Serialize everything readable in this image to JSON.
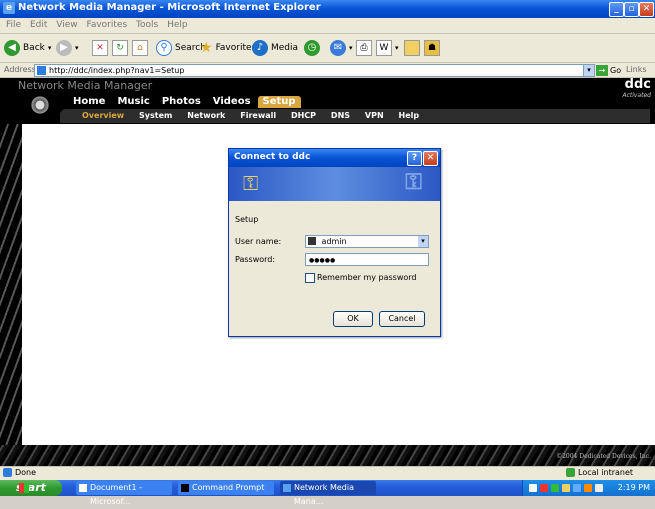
{
  "window": {
    "title": "Network Media Manager - Microsoft Internet Explorer",
    "minimize": "_",
    "maximize": "▫",
    "close": "✕"
  },
  "menubar": {
    "items": [
      "File",
      "Edit",
      "View",
      "Favorites",
      "Tools",
      "Help"
    ]
  },
  "toolbar": {
    "back": "Back",
    "search": "Search",
    "favorites": "Favorites",
    "media": "Media"
  },
  "addressbar": {
    "label": "Address",
    "url": "http://ddc/index.php?nav1=Setup",
    "go": "Go",
    "links": "Links"
  },
  "site": {
    "title": "Network Media Manager",
    "logo": "ddc",
    "logo_sub": "Activated",
    "main_nav": [
      "Home",
      "Music",
      "Photos",
      "Videos",
      "Setup"
    ],
    "main_nav_active": "Setup",
    "sub_nav": [
      "Overview",
      "System",
      "Network",
      "Firewall",
      "DHCP",
      "DNS",
      "VPN",
      "Help"
    ],
    "sub_nav_active": "Overview",
    "copyright": "©2004 Dedicated Devices, Inc.",
    "accent": "#d9a640"
  },
  "dialog": {
    "title": "Connect to ddc",
    "help_btn": "?",
    "close_btn": "✕",
    "realm": "Setup",
    "username_label": "User name:",
    "username_value": "admin",
    "password_label": "Password:",
    "password_value": "●●●●●",
    "remember_label": "Remember my password",
    "remember_checked": false,
    "ok": "OK",
    "cancel": "Cancel"
  },
  "statusbar": {
    "status": "Done",
    "zone": "Local intranet"
  },
  "taskbar": {
    "start": "start",
    "tasks": [
      "Document1 - Microsof...",
      "Command Prompt",
      "Network Media Mana..."
    ],
    "clock": "2:19 PM"
  }
}
